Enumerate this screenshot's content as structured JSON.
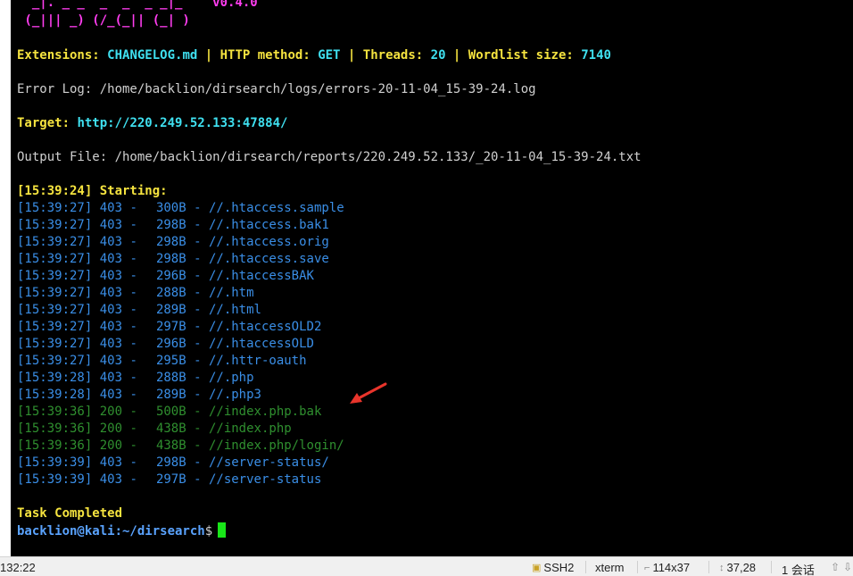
{
  "terminal": {
    "banner_line1": "  _|. _ _  _  _  _ _|_    ",
    "banner_line2": " (_||| _) (/_(_|| (_| )",
    "version": "v0.4.0",
    "info": {
      "extensions_label": "Extensions: ",
      "extensions_value": "CHANGELOG.md",
      "sep1": " | ",
      "method_label": "HTTP method: ",
      "method_value": "GET",
      "sep2": " | ",
      "threads_label": "Threads: ",
      "threads_value": "20",
      "sep3": " | ",
      "wordlist_label": "Wordlist size: ",
      "wordlist_value": "7140"
    },
    "error_log": "Error Log: /home/backlion/dirsearch/logs/errors-20-11-04_15-39-24.log",
    "target_label": "Target: ",
    "target_value": "http://220.249.52.133:47884/",
    "output_file": "Output File: /home/backlion/dirsearch/reports/220.249.52.133/_20-11-04_15-39-24.txt",
    "starting": "[15:39:24] Starting:",
    "results": [
      {
        "time": "[15:39:27]",
        "status": "403",
        "size": "300B",
        "path": "//.htaccess.sample",
        "color": "blue"
      },
      {
        "time": "[15:39:27]",
        "status": "403",
        "size": "298B",
        "path": "//.htaccess.bak1",
        "color": "blue"
      },
      {
        "time": "[15:39:27]",
        "status": "403",
        "size": "298B",
        "path": "//.htaccess.orig",
        "color": "blue"
      },
      {
        "time": "[15:39:27]",
        "status": "403",
        "size": "298B",
        "path": "//.htaccess.save",
        "color": "blue"
      },
      {
        "time": "[15:39:27]",
        "status": "403",
        "size": "296B",
        "path": "//.htaccessBAK",
        "color": "blue"
      },
      {
        "time": "[15:39:27]",
        "status": "403",
        "size": "288B",
        "path": "//.htm",
        "color": "blue"
      },
      {
        "time": "[15:39:27]",
        "status": "403",
        "size": "289B",
        "path": "//.html",
        "color": "blue"
      },
      {
        "time": "[15:39:27]",
        "status": "403",
        "size": "297B",
        "path": "//.htaccessOLD2",
        "color": "blue"
      },
      {
        "time": "[15:39:27]",
        "status": "403",
        "size": "296B",
        "path": "//.htaccessOLD",
        "color": "blue"
      },
      {
        "time": "[15:39:27]",
        "status": "403",
        "size": "295B",
        "path": "//.httr-oauth",
        "color": "blue"
      },
      {
        "time": "[15:39:28]",
        "status": "403",
        "size": "288B",
        "path": "//.php",
        "color": "blue"
      },
      {
        "time": "[15:39:28]",
        "status": "403",
        "size": "289B",
        "path": "//.php3",
        "color": "blue"
      },
      {
        "time": "[15:39:36]",
        "status": "200",
        "size": "500B",
        "path": "//index.php.bak",
        "color": "green"
      },
      {
        "time": "[15:39:36]",
        "status": "200",
        "size": "438B",
        "path": "//index.php",
        "color": "green"
      },
      {
        "time": "[15:39:36]",
        "status": "200",
        "size": "438B",
        "path": "//index.php/login/",
        "color": "green"
      },
      {
        "time": "[15:39:39]",
        "status": "403",
        "size": "298B",
        "path": "//server-status/",
        "color": "blue"
      },
      {
        "time": "[15:39:39]",
        "status": "403",
        "size": "297B",
        "path": "//server-status",
        "color": "blue"
      }
    ],
    "task_completed": "Task Completed",
    "prompt_user": "backlion@kali",
    "prompt_path": ":~/dirsearch",
    "prompt_symbol": "$"
  },
  "statusbar": {
    "time": "132:22",
    "protocol": "SSH2",
    "terminal_type": "xterm",
    "size": "114x37",
    "cursor_pos": "37,28",
    "sessions": "1 会话"
  },
  "colors": {
    "background": "#000000",
    "blue_rows": "#3a8ee6",
    "green_rows": "#2f8f2f",
    "yellow": "#f5e33f",
    "cyan": "#3fe0f0",
    "magenta": "#ff3df0",
    "cursor": "#19e619",
    "annotation_arrow": "#e8342b"
  }
}
